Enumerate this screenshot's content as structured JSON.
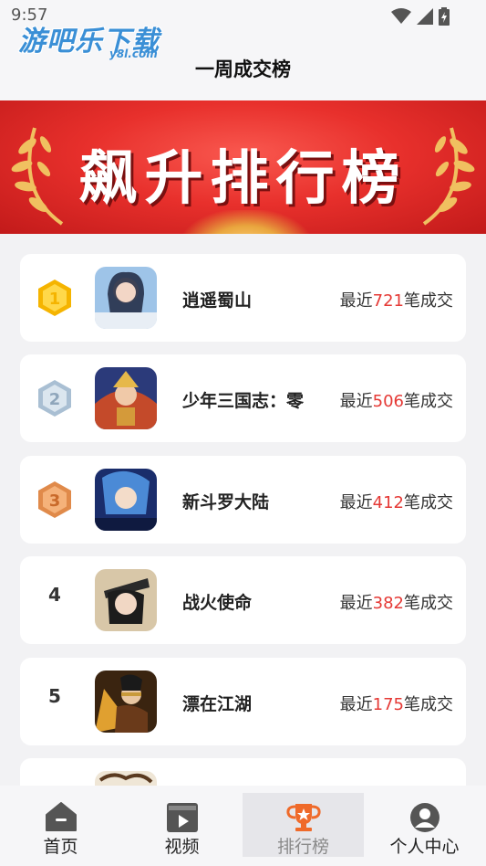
{
  "status": {
    "time": "9:57"
  },
  "watermark": {
    "text": "游吧乐下载",
    "sub": "y8l.com"
  },
  "header": {
    "title": "一周成交榜"
  },
  "banner": {
    "title": "飙升排行榜"
  },
  "deal_prefix": "最近",
  "deal_suffix": "笔成交",
  "ranking": [
    {
      "rank": "1",
      "name": "逍遥蜀山",
      "deals": "721",
      "badge_color": "#f5b400"
    },
    {
      "rank": "2",
      "name": "少年三国志：零",
      "deals": "506",
      "badge_color": "#a9bfd3"
    },
    {
      "rank": "3",
      "name": "新斗罗大陆",
      "deals": "412",
      "badge_color": "#e08a4a"
    },
    {
      "rank": "4",
      "name": "战火使命",
      "deals": "382"
    },
    {
      "rank": "5",
      "name": "漂在江湖",
      "deals": "175"
    }
  ],
  "tabs": [
    {
      "label": "首页",
      "icon": "home-icon"
    },
    {
      "label": "视频",
      "icon": "video-icon"
    },
    {
      "label": "排行榜",
      "icon": "trophy-icon",
      "active": true
    },
    {
      "label": "个人中心",
      "icon": "user-icon"
    }
  ],
  "colors": {
    "accent_red": "#e53935",
    "trophy_orange": "#ef6a2a"
  }
}
